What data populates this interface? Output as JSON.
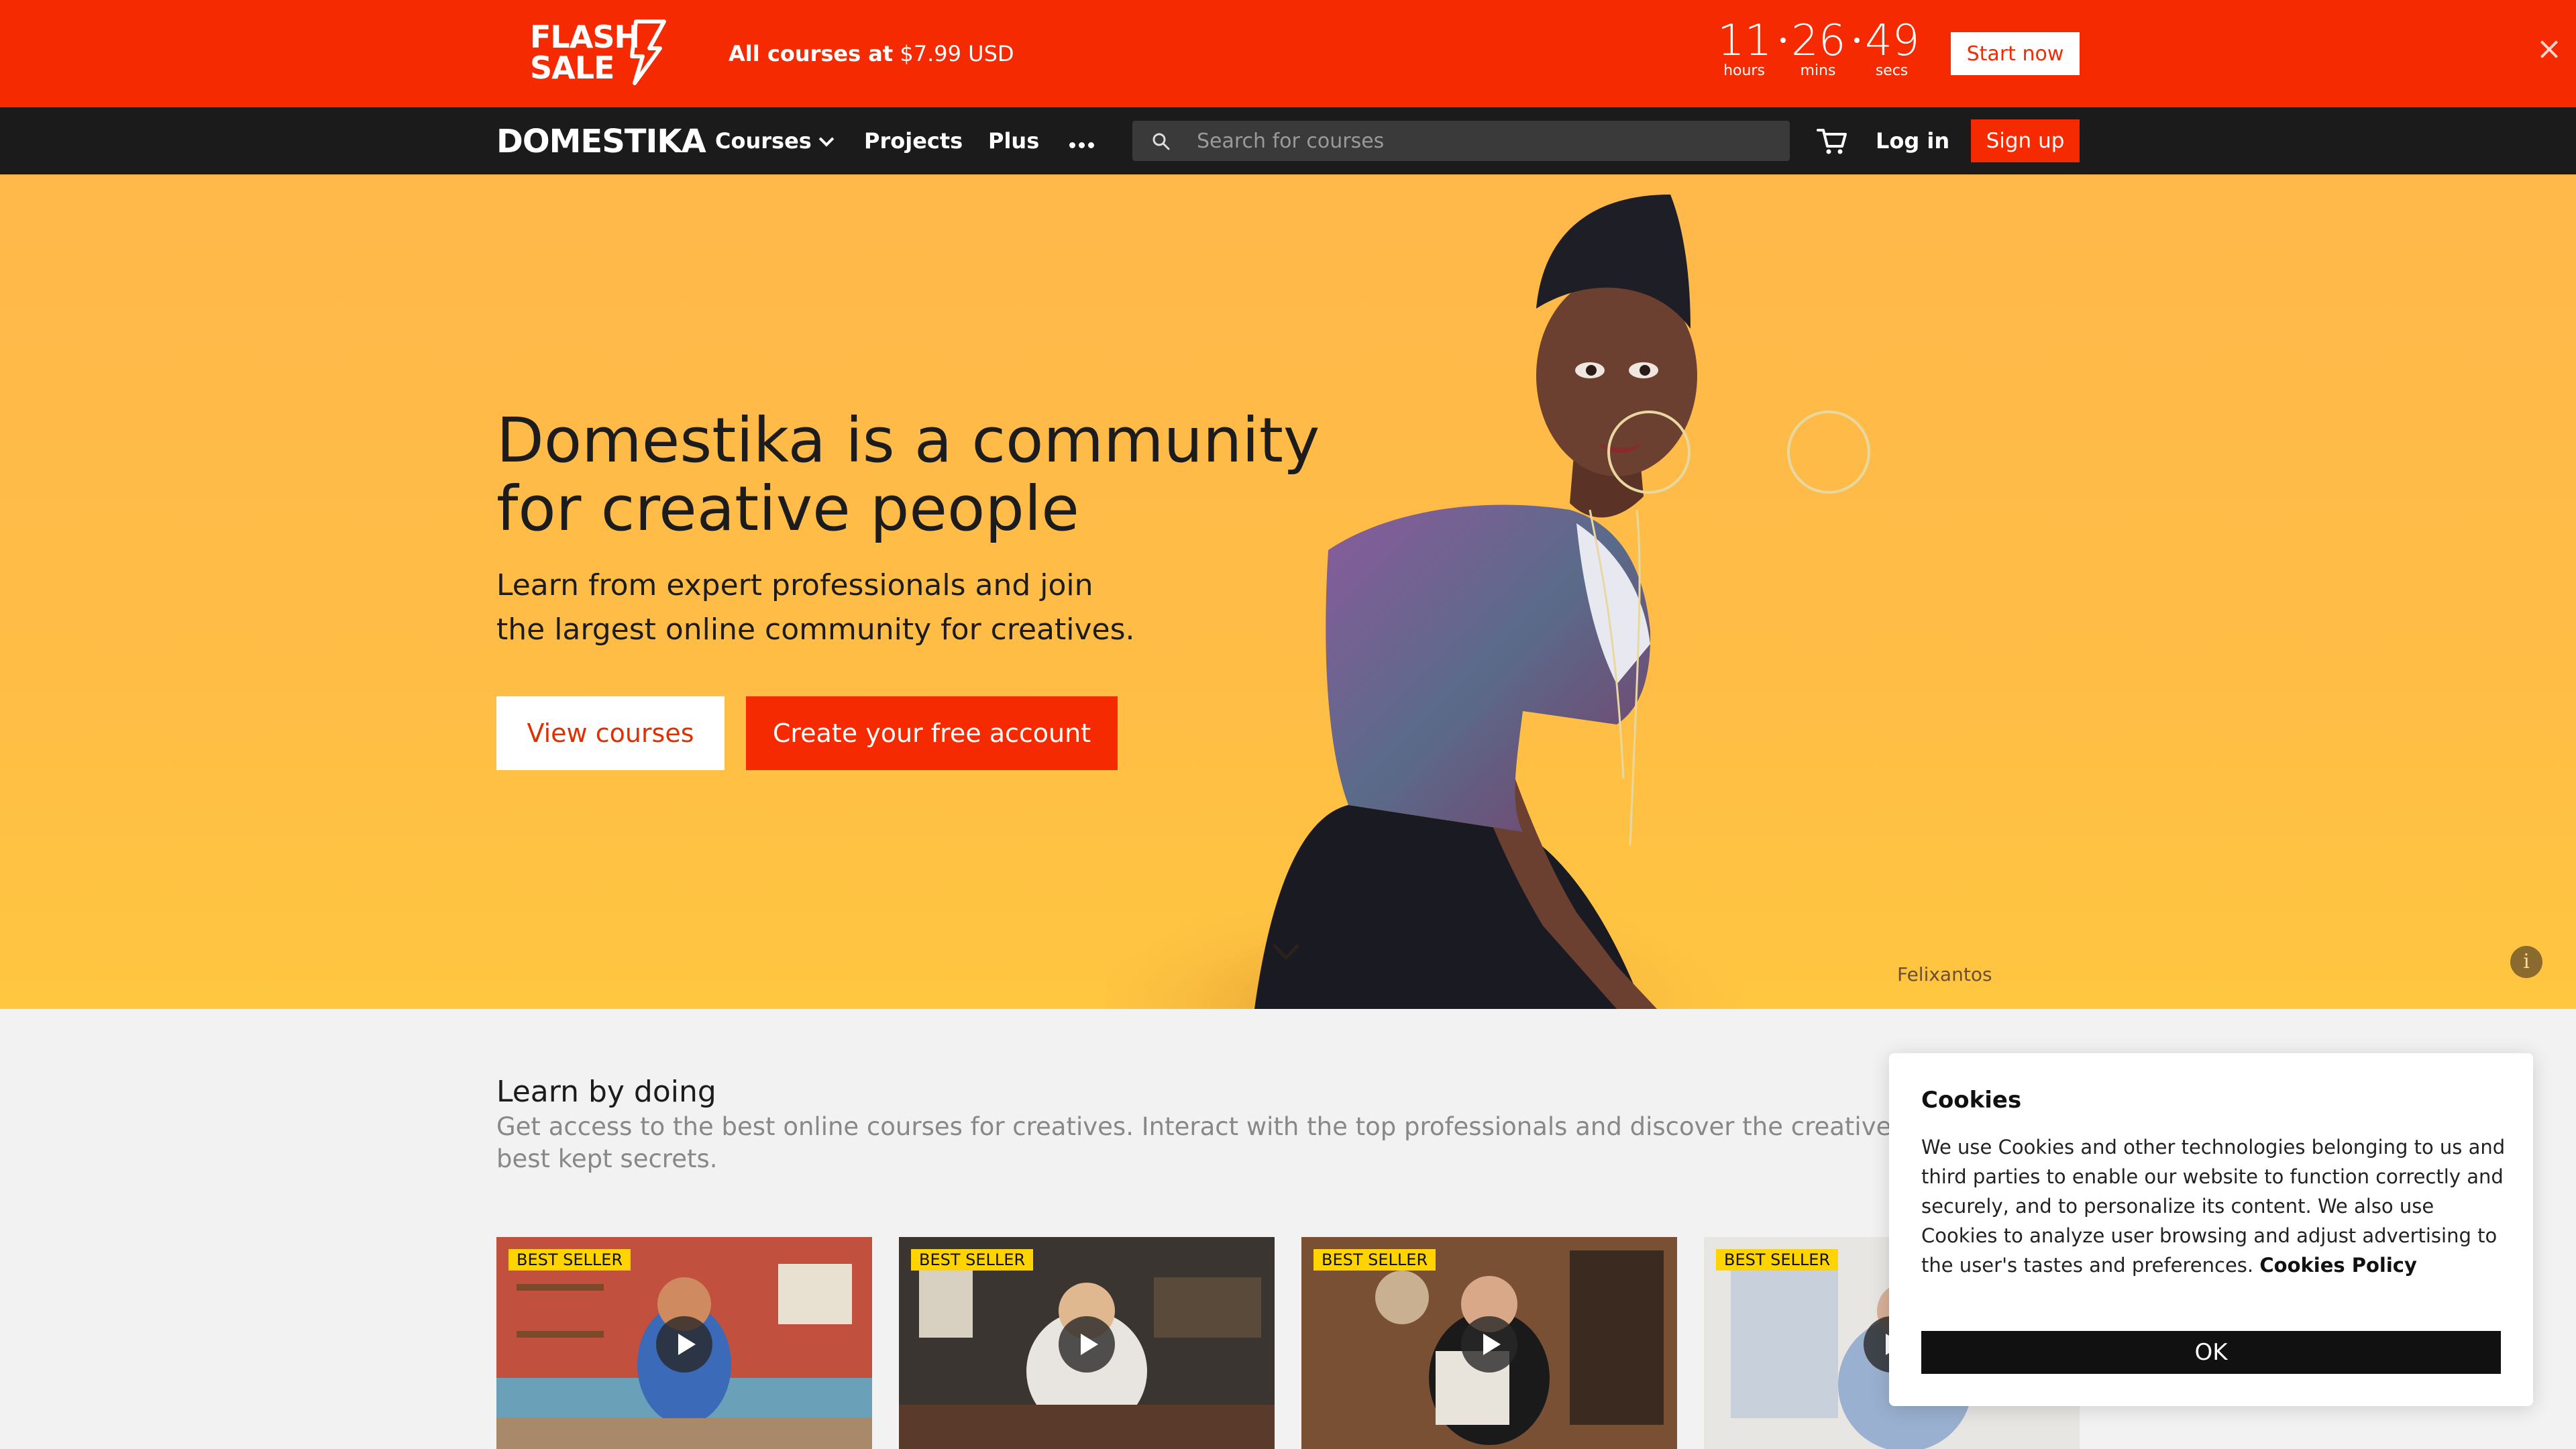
{
  "flash_sale": {
    "logo_line1": "FLASH",
    "logo_line2": "SALE",
    "text_bold": "All courses at",
    "text_price": "$7.99 USD",
    "countdown": {
      "hours": "11",
      "hours_label": "hours",
      "mins": "26",
      "mins_label": "mins",
      "secs": "49",
      "secs_label": "secs"
    },
    "start_label": "Start now",
    "close_icon": "×"
  },
  "nav": {
    "logo": "DOMESTIKA",
    "items": [
      "Courses",
      "Projects",
      "Plus"
    ],
    "search_placeholder": "Search for courses",
    "login_label": "Log in",
    "signup_label": "Sign up"
  },
  "hero": {
    "title": "Domestika is a community for creative people",
    "subtitle_line1": "Learn from expert professionals and join",
    "subtitle_line2": "the largest online community for creatives.",
    "view_courses_label": "View courses",
    "create_account_label": "Create your free account",
    "artist_credit": "Felixantos",
    "info_icon": "i"
  },
  "learn": {
    "title": "Learn by doing",
    "subtitle": "Get access to the best online courses for creatives. Interact with the top professionals and discover the creative world's best kept secrets.",
    "cards": [
      {
        "badge": "BEST SELLER"
      },
      {
        "badge": "BEST SELLER"
      },
      {
        "badge": "BEST SELLER"
      },
      {
        "badge": "BEST SELLER"
      }
    ]
  },
  "cookies": {
    "title": "Cookies",
    "text": "We use Cookies and other technologies belonging to us and third parties to enable our website to function correctly and securely, and to personalize its content. We also use Cookies to analyze user browsing and adjust advertising to the user's tastes and preferences.",
    "policy_link": "Cookies Policy",
    "ok_label": "OK"
  },
  "colors": {
    "brand_red": "#f52a00",
    "hero_yellow": "#ffbd46",
    "nav_dark": "#1b1b1b",
    "badge_yellow": "#ffd400"
  }
}
